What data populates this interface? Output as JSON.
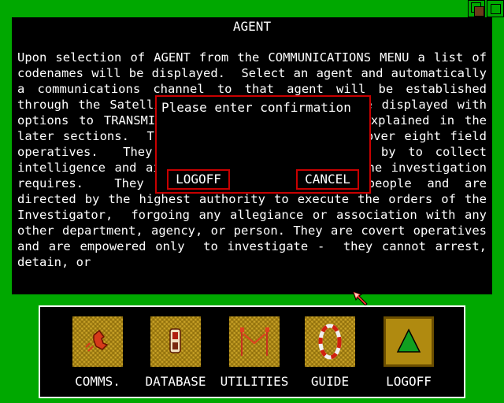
{
  "panel": {
    "title": "AGENT",
    "body": "Upon selection of AGENT from the COMMUNICATIONS MENU a list of codenames will be displayed.  Select an agent and automatically a communications channel to that agent will be established through the Satellite Network.  A menu will be displayed with options to TRANSMIT and RECEIVE.  These are explained in the later sections.  The investigator has command over eight field operatives.  They are the field agents sent by to collect intelligence and aid the Investigator and as the investigation requires.  They are trained, experienced people and are directed by the highest authority to execute the orders of the Investigator,  forgoing any allegiance or association with any other department, agency, or person. They are covert operatives and are empowered only  to investigate -  they cannot arrest, detain, or"
  },
  "dialog": {
    "prompt": "Please enter confirmation",
    "logoff_label": "LOGOFF",
    "cancel_label": "CANCEL"
  },
  "dock": {
    "items": [
      {
        "label": "COMMS.",
        "icon": "comms-icon"
      },
      {
        "label": "DATABASE",
        "icon": "database-icon"
      },
      {
        "label": "UTILITIES",
        "icon": "utilities-icon"
      },
      {
        "label": "GUIDE",
        "icon": "guide-icon"
      },
      {
        "label": "LOGOFF",
        "icon": "logoff-triangle-icon"
      }
    ]
  },
  "colors": {
    "desktop": "#00a800",
    "panel": "#000000",
    "dialog_border": "#c80000",
    "icon_tile": "#c9a227",
    "text": "#ffffff"
  }
}
